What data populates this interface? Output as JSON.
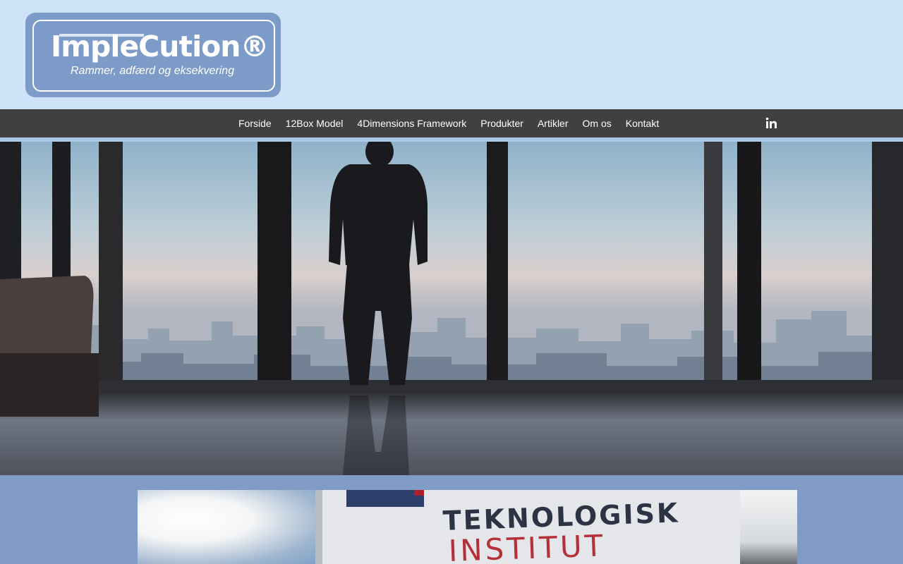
{
  "logo": {
    "title": "ImpleCution®",
    "tagline": "Rammer, adfærd og eksekvering"
  },
  "nav": {
    "items": [
      {
        "label": "Forside"
      },
      {
        "label": "12Box Model"
      },
      {
        "label": "4Dimensions Framework"
      },
      {
        "label": "Produkter"
      },
      {
        "label": "Artikler"
      },
      {
        "label": "Om os"
      },
      {
        "label": "Kontakt"
      }
    ],
    "social_icon": "linkedin-icon"
  },
  "hero": {
    "image": "silhouette-man-window-city-view"
  },
  "feature_image": {
    "image": "teknologisk-institut-sign",
    "sign_line1": "TEKNOLOGISK",
    "sign_line2": "INSTITUT"
  },
  "colors": {
    "header_bg": "#cfe3f8",
    "logo_bg": "#7d9bc8",
    "nav_bg": "#404040",
    "section_bg": "#809bc6"
  }
}
